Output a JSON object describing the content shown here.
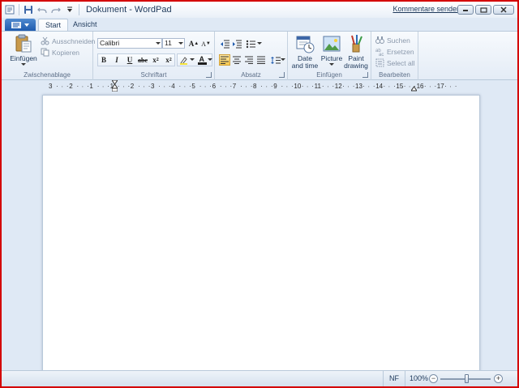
{
  "window": {
    "title": "Dokument - WordPad",
    "feedback_link": "Kommentare senden"
  },
  "tabs": [
    {
      "label": "Start",
      "active": true
    },
    {
      "label": "Ansicht",
      "active": false
    }
  ],
  "ribbon": {
    "clipboard": {
      "label": "Zwischenablage",
      "paste": "Einfügen",
      "cut": "Ausschneiden",
      "copy": "Kopieren"
    },
    "font": {
      "label": "Schriftart",
      "family": "Calibri",
      "size": "11"
    },
    "paragraph": {
      "label": "Absatz"
    },
    "insert": {
      "label": "Einfügen",
      "datetime": "Date and time",
      "picture": "Picture",
      "paint": "Paint drawing"
    },
    "editing": {
      "label": "Bearbeiten",
      "find": "Suchen",
      "replace": "Ersetzen",
      "selectall": "Select all"
    }
  },
  "ruler": {
    "labels": [
      "3",
      "2",
      "1",
      "1",
      "2",
      "3",
      "4",
      "5",
      "6",
      "7",
      "8",
      "9",
      "10",
      "11",
      "12",
      "13",
      "14",
      "15",
      "16",
      "17"
    ]
  },
  "status": {
    "nf": "NF",
    "zoom": "100%"
  },
  "colors": {
    "accent": "#1f5bae",
    "window_border": "#d40000",
    "ribbon_bg": "#dfe9f5"
  }
}
